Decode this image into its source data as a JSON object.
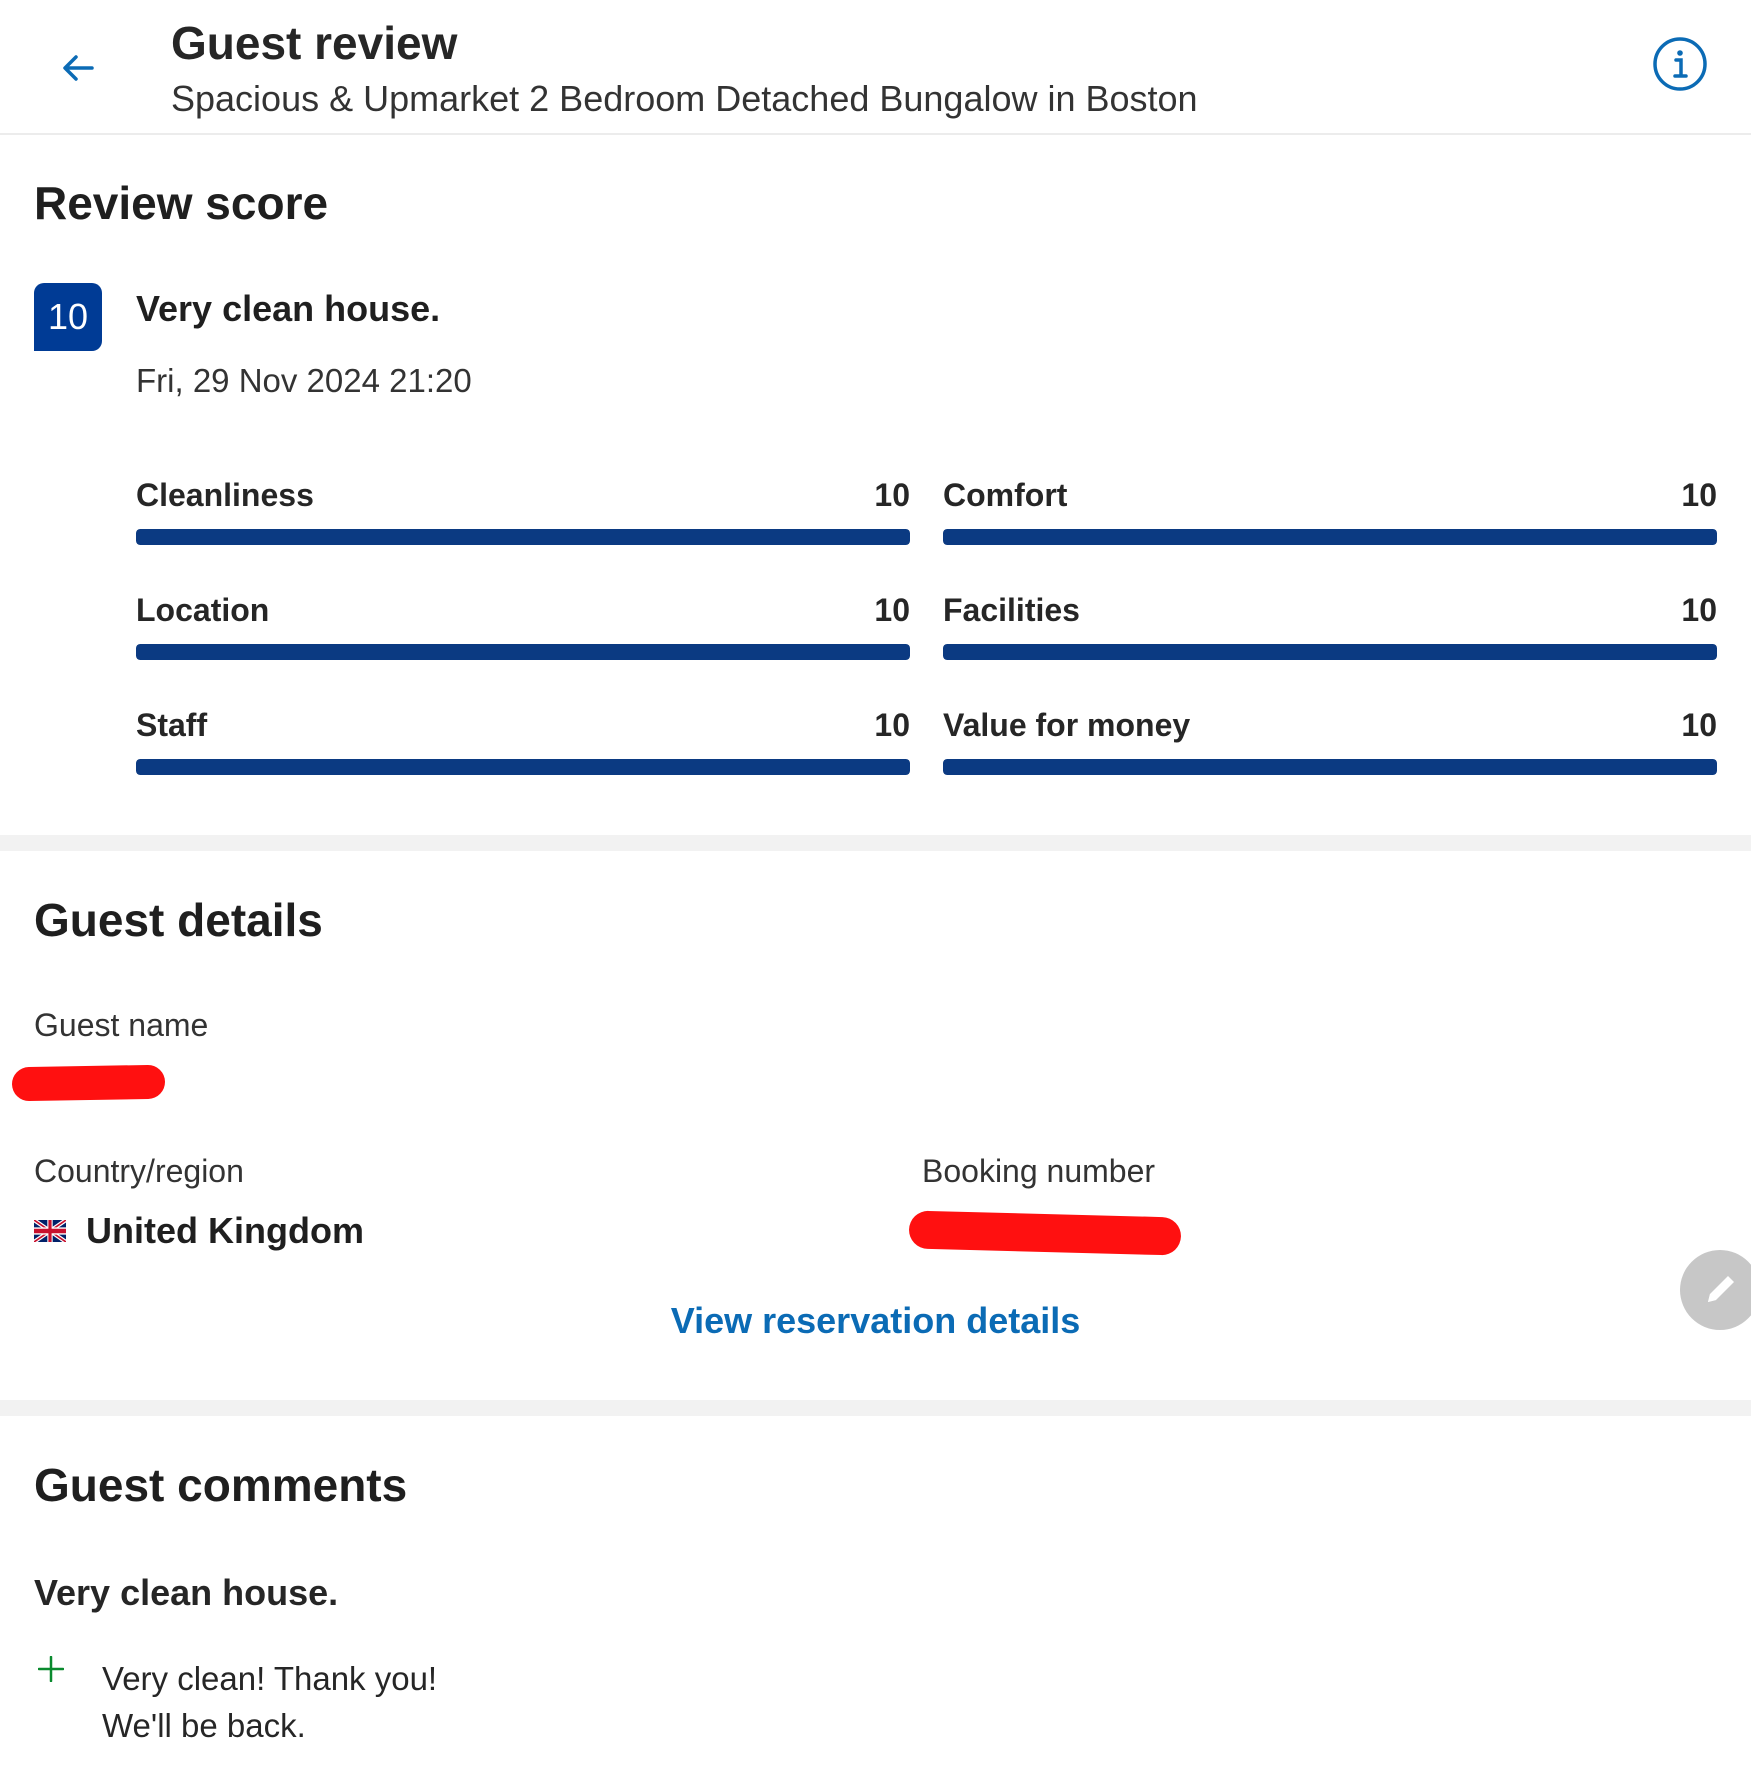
{
  "header": {
    "title": "Guest review",
    "subtitle": "Spacious & Upmarket 2 Bedroom Detached Bungalow in Boston",
    "back_icon": "arrow-left-icon",
    "info_icon": "info-icon",
    "accent_color": "#0b6bb5"
  },
  "review_score": {
    "section_title": "Review score",
    "score": "10",
    "headline": "Very clean house.",
    "date": "Fri, 29 Nov 2024 21:20",
    "badge_color": "#003b95",
    "bar_color": "#0b3a82",
    "categories": [
      {
        "label": "Cleanliness",
        "value": "10",
        "fraction": 1.0
      },
      {
        "label": "Comfort",
        "value": "10",
        "fraction": 1.0
      },
      {
        "label": "Location",
        "value": "10",
        "fraction": 1.0
      },
      {
        "label": "Facilities",
        "value": "10",
        "fraction": 1.0
      },
      {
        "label": "Staff",
        "value": "10",
        "fraction": 1.0
      },
      {
        "label": "Value for money",
        "value": "10",
        "fraction": 1.0
      }
    ]
  },
  "guest_details": {
    "section_title": "Guest details",
    "guest_name_label": "Guest name",
    "country_label": "Country/region",
    "country_value": "United Kingdom",
    "country_flag": "uk-flag-icon",
    "booking_number_label": "Booking number",
    "view_reservation_link": "View reservation details",
    "redaction_color": "#ff1010"
  },
  "guest_comments": {
    "section_title": "Guest comments",
    "headline": "Very clean house.",
    "positive_icon": "plus-icon",
    "positive_lines": [
      "Very clean! Thank you!",
      "We'll be back."
    ]
  },
  "edit_icon": "pencil-icon"
}
